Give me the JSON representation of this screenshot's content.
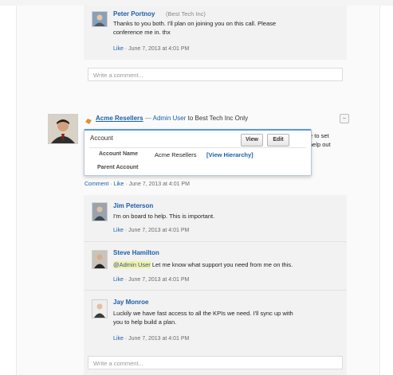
{
  "post_top": {
    "author": "Peter Portnoy",
    "company": "(Best Tech Inc)",
    "text_line1": "Thanks to you both. I'll plan on joining you on this call. Please",
    "text_line2": "conference me in. thx",
    "like": "Like",
    "date": "June 7, 2013 at 4:01 PM",
    "comment_placeholder": "Write a comment..."
  },
  "main_post": {
    "account_name": "Acme Resellers",
    "separator": "—",
    "user": "Admin User",
    "audience": "to Best Tech Inc Only",
    "peek_line1": "e to set",
    "peek_line2": "help out",
    "actions": {
      "comment": "Comment",
      "like": "Like",
      "date": "June 7, 2013 at 4:01 PM"
    },
    "collapse_glyph": "−"
  },
  "hover_card": {
    "title": "Account",
    "view_button": "View",
    "edit_button": "Edit",
    "account_name_label": "Account Name",
    "account_name_value": "Acme Resellers",
    "view_hierarchy": "[View Hierarchy]",
    "parent_account_label": "Parent Account"
  },
  "comments": [
    {
      "author": "Jim Peterson",
      "text": "I'm on board to help. This is important.",
      "like": "Like",
      "date": "June 7, 2013 at 4:01 PM"
    },
    {
      "author": "Steve Hamilton",
      "mention": "@Admin User",
      "text": " Let me know what support you need from me on this.",
      "like": "Like",
      "date": "June 7, 2013 at 4:01 PM"
    },
    {
      "author": "Jay Monroe",
      "text_line1": "Luckily we have fast access to all the KPIs we need. I'll sync up with",
      "text_line2": "you to help build a plan.",
      "like": "Like",
      "date": "June 7, 2013 at 4:01 PM"
    }
  ],
  "bottom_comment_placeholder": "Write a comment...",
  "colors": {
    "link": "#1b5fa6",
    "accent": "#5b9bd5",
    "mention_highlight": "#f6f0a0"
  }
}
